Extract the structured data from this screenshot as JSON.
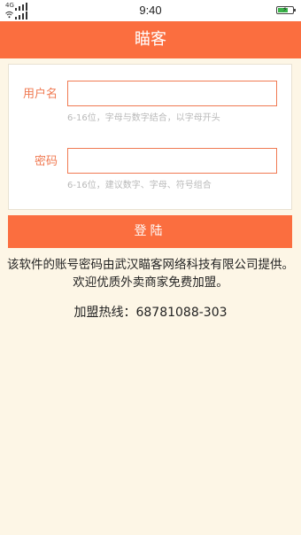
{
  "status_bar": {
    "signal_1_label": "4G",
    "signal_2_label": "",
    "time": "9:40",
    "battery_icon": "battery-charging-icon",
    "colors": {
      "battery_fill": "#3bb44a"
    }
  },
  "header": {
    "title": "瞄客",
    "color": "#fb6e3f"
  },
  "form": {
    "username": {
      "label": "用户名",
      "value": "",
      "placeholder": "",
      "hint": "6-16位，字母与数字结合，以字母开头"
    },
    "password": {
      "label": "密码",
      "value": "",
      "placeholder": "",
      "hint": "6-16位，建议数字、字母、符号组合"
    },
    "login_label": "登陆"
  },
  "info": {
    "description": "该软件的账号密码由武汉瞄客网络科技有限公司提供。欢迎优质外卖商家免费加盟。",
    "hotline": "加盟热线：68781088-303"
  }
}
